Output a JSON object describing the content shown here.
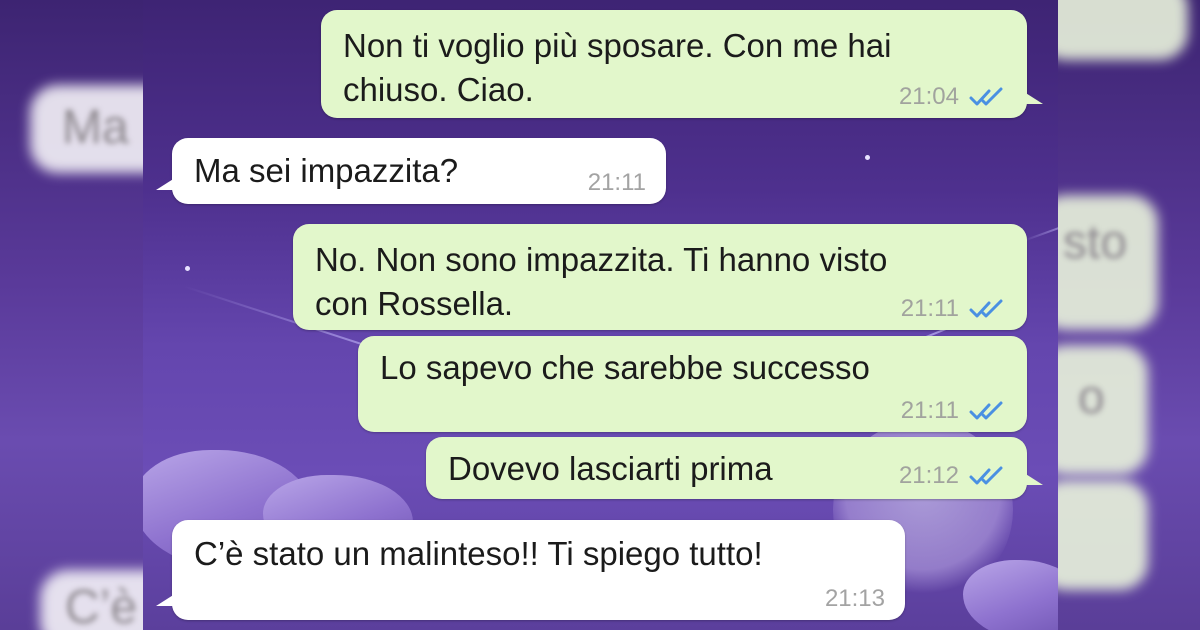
{
  "messages": [
    {
      "direction": "outgoing",
      "lines": [
        "Non ti voglio più sposare. Con me hai",
        "chiuso. Ciao."
      ],
      "time": "21:04",
      "status": "read"
    },
    {
      "direction": "incoming",
      "lines": [
        "Ma sei impazzita?"
      ],
      "time": "21:11"
    },
    {
      "direction": "outgoing",
      "lines": [
        "No. Non sono impazzita. Ti hanno visto",
        "con Rossella."
      ],
      "time": "21:11",
      "status": "read"
    },
    {
      "direction": "outgoing",
      "lines": [
        "Lo sapevo che sarebbe successo"
      ],
      "time": "21:11",
      "status": "read"
    },
    {
      "direction": "outgoing",
      "lines": [
        "Dovevo lasciarti prima"
      ],
      "time": "21:12",
      "status": "read"
    },
    {
      "direction": "incoming",
      "lines": [
        "C’è stato un malinteso!! Ti spiego tutto!"
      ],
      "time": "21:13"
    }
  ],
  "background_fragments": {
    "left": [
      "Ma",
      "C’è"
    ],
    "right": [
      "sto",
      "o"
    ]
  },
  "colors": {
    "outgoing_bubble": "#e2f7cb",
    "incoming_bubble": "#ffffff",
    "read_ticks": "#4a90e2",
    "timestamp": "#a1a39e",
    "wallpaper": "#4e308e"
  },
  "icons": {
    "read_status": "double-check-icon"
  }
}
